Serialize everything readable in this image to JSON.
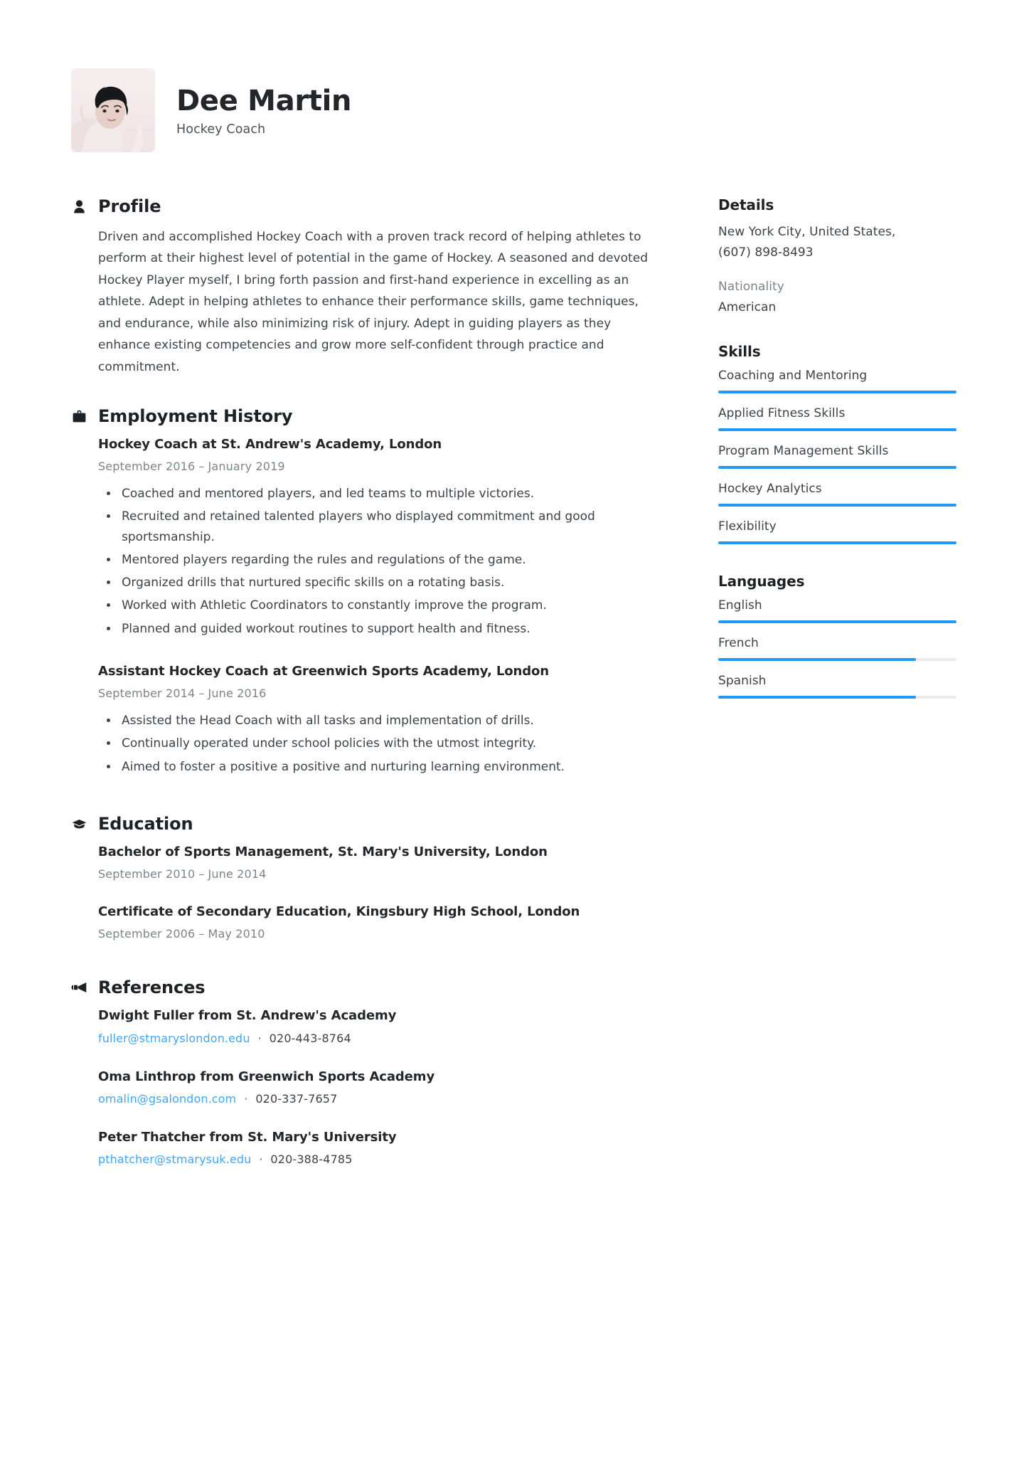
{
  "theme": {
    "accent": "#2196f3",
    "link": "#44a6f5",
    "text": "#3b4349",
    "heading": "#1c2126",
    "muted": "#7a858d",
    "track": "#ebebeb"
  },
  "header": {
    "name": "Dee Martin",
    "title": "Hockey Coach",
    "avatar_icon": "portrait-photo"
  },
  "sections": {
    "profile": {
      "icon": "person-icon",
      "title": "Profile",
      "text": "Driven and accomplished Hockey Coach with a proven track record of helping athletes to perform at their highest level of potential in the game of Hockey. A seasoned and devoted Hockey Player myself, I bring forth passion and first-hand experience in excelling as an athlete. Adept in helping athletes to enhance their performance skills, game techniques, and endurance, while also minimizing risk of injury. Adept in guiding players as they enhance existing competencies and grow more self-confident through practice and commitment."
    },
    "employment": {
      "icon": "briefcase-icon",
      "title": "Employment History",
      "entries": [
        {
          "title": "Hockey Coach at St. Andrew's Academy, London",
          "start": "September 2016",
          "dash": "–",
          "end": "January 2019",
          "bullets": [
            "Coached and mentored players, and led teams to multiple victories.",
            "Recruited and retained talented players who displayed commitment and good sportsmanship.",
            "Mentored players regarding the rules and regulations of the game.",
            "Organized drills that nurtured specific skills on a rotating basis.",
            "Worked with Athletic Coordinators to constantly improve the program.",
            "Planned and guided workout routines to support health and fitness."
          ]
        },
        {
          "title": "Assistant Hockey Coach at Greenwich Sports Academy, London",
          "start": "September 2014",
          "dash": "–",
          "end": "June 2016",
          "bullets": [
            "Assisted the Head Coach with all tasks and implementation of drills.",
            "Continually operated under school policies with the utmost integrity.",
            "Aimed to foster a positive a positive and nurturing learning environment."
          ]
        }
      ]
    },
    "education": {
      "icon": "graduation-cap-icon",
      "title": "Education",
      "entries": [
        {
          "title": "Bachelor of Sports Management, St. Mary's University, London",
          "start": "September 2010",
          "dash": "–",
          "end": "June 2014"
        },
        {
          "title": "Certificate of Secondary Education, Kingsbury High School, London",
          "start": "September 2006",
          "dash": "–",
          "end": "May 2010"
        }
      ]
    },
    "references": {
      "icon": "megaphone-icon",
      "title": "References",
      "entries": [
        {
          "title": "Dwight Fuller from St. Andrew's Academy",
          "email": "fuller@stmaryslondon.edu",
          "separator": "·",
          "phone": "020-443-8764"
        },
        {
          "title": "Oma Linthrop from Greenwich Sports Academy",
          "email": "omalin@gsalondon.com",
          "separator": "·",
          "phone": "020-337-7657"
        },
        {
          "title": "Peter Thatcher from St. Mary's University",
          "email": "pthatcher@stmarysuk.edu",
          "separator": "·",
          "phone": "020-388-4785"
        }
      ]
    }
  },
  "sidebar": {
    "details": {
      "title": "Details",
      "location": "New York City, United States,",
      "phone": "(607) 898-8493",
      "nationality_label": "Nationality",
      "nationality_value": "American"
    },
    "skills": {
      "title": "Skills",
      "items": [
        {
          "label": "Coaching and Mentoring",
          "level": 100
        },
        {
          "label": "Applied Fitness Skills",
          "level": 100
        },
        {
          "label": "Program Management Skills",
          "level": 100
        },
        {
          "label": "Hockey Analytics",
          "level": 100
        },
        {
          "label": "Flexibility",
          "level": 100
        }
      ]
    },
    "languages": {
      "title": "Languages",
      "items": [
        {
          "label": "English",
          "level": 100
        },
        {
          "label": "French",
          "level": 83
        },
        {
          "label": "Spanish",
          "level": 83
        }
      ]
    }
  }
}
